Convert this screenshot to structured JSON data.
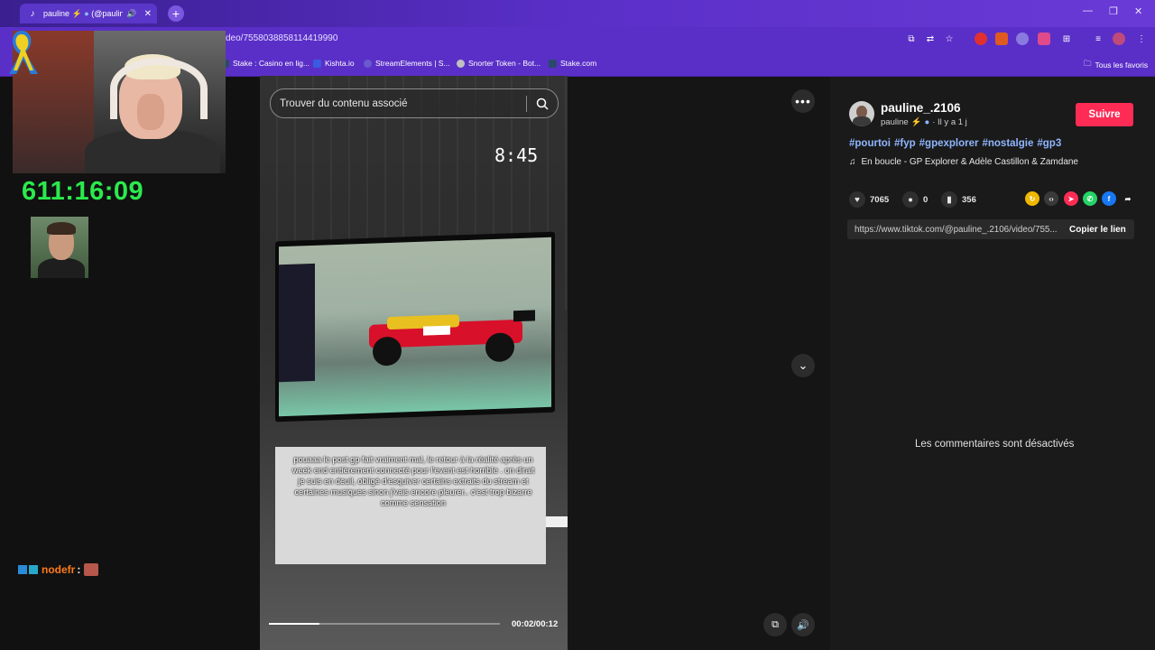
{
  "browser": {
    "tab_title": "pauline",
    "tab_title_suffix": "(@pauline_.",
    "url": "deo/7558038858114419990",
    "bookmarks": [
      {
        "label": "Stake : Casino en lig...",
        "color": "#1a3a5a"
      },
      {
        "label": "Kishta.io",
        "color": "#3a5ae0"
      },
      {
        "label": "StreamElements | S...",
        "color": "#6a5ad0"
      },
      {
        "label": "Snorter Token - Bot...",
        "color": "#c0c0c0"
      },
      {
        "label": "Stake.com",
        "color": "#1a3a5a"
      }
    ],
    "favorites_label": "Tous les favoris"
  },
  "stream": {
    "timer": "611:16:09",
    "chat": {
      "user": "nodefr",
      "colon": ":"
    }
  },
  "video": {
    "search_placeholder": "Trouver du contenu associé",
    "clock": "8:45",
    "caption": "pouaaa le post gp fait vraiment mal, le retour à la réalité après un week end entièrement connecté pour l'event est horrible . on dirait je suis en deuil, obligé d'esquiver certains extraits du stream et certaines musiques sinon j'vais encore pleurer.. c'est trop bizarre comme sensation",
    "time": "00:02/00:12",
    "progress_fraction": 0.22
  },
  "post": {
    "username": "pauline_.2106",
    "display_name": "pauline",
    "posted": "· Il y a 1 j",
    "follow_label": "Suivre",
    "hashtags": [
      "#pourtoi",
      "#fyp",
      "#gpexplorer",
      "#nostalgie",
      "#gp3"
    ],
    "music": "En boucle - GP Explorer & Adèle Castillon & Zamdane",
    "likes": "7065",
    "comments": "0",
    "saves": "356",
    "link": "https://www.tiktok.com/@pauline_.2106/video/755...",
    "copy_label": "Copier le lien",
    "comments_disabled": "Les commentaires sont désactivés"
  }
}
